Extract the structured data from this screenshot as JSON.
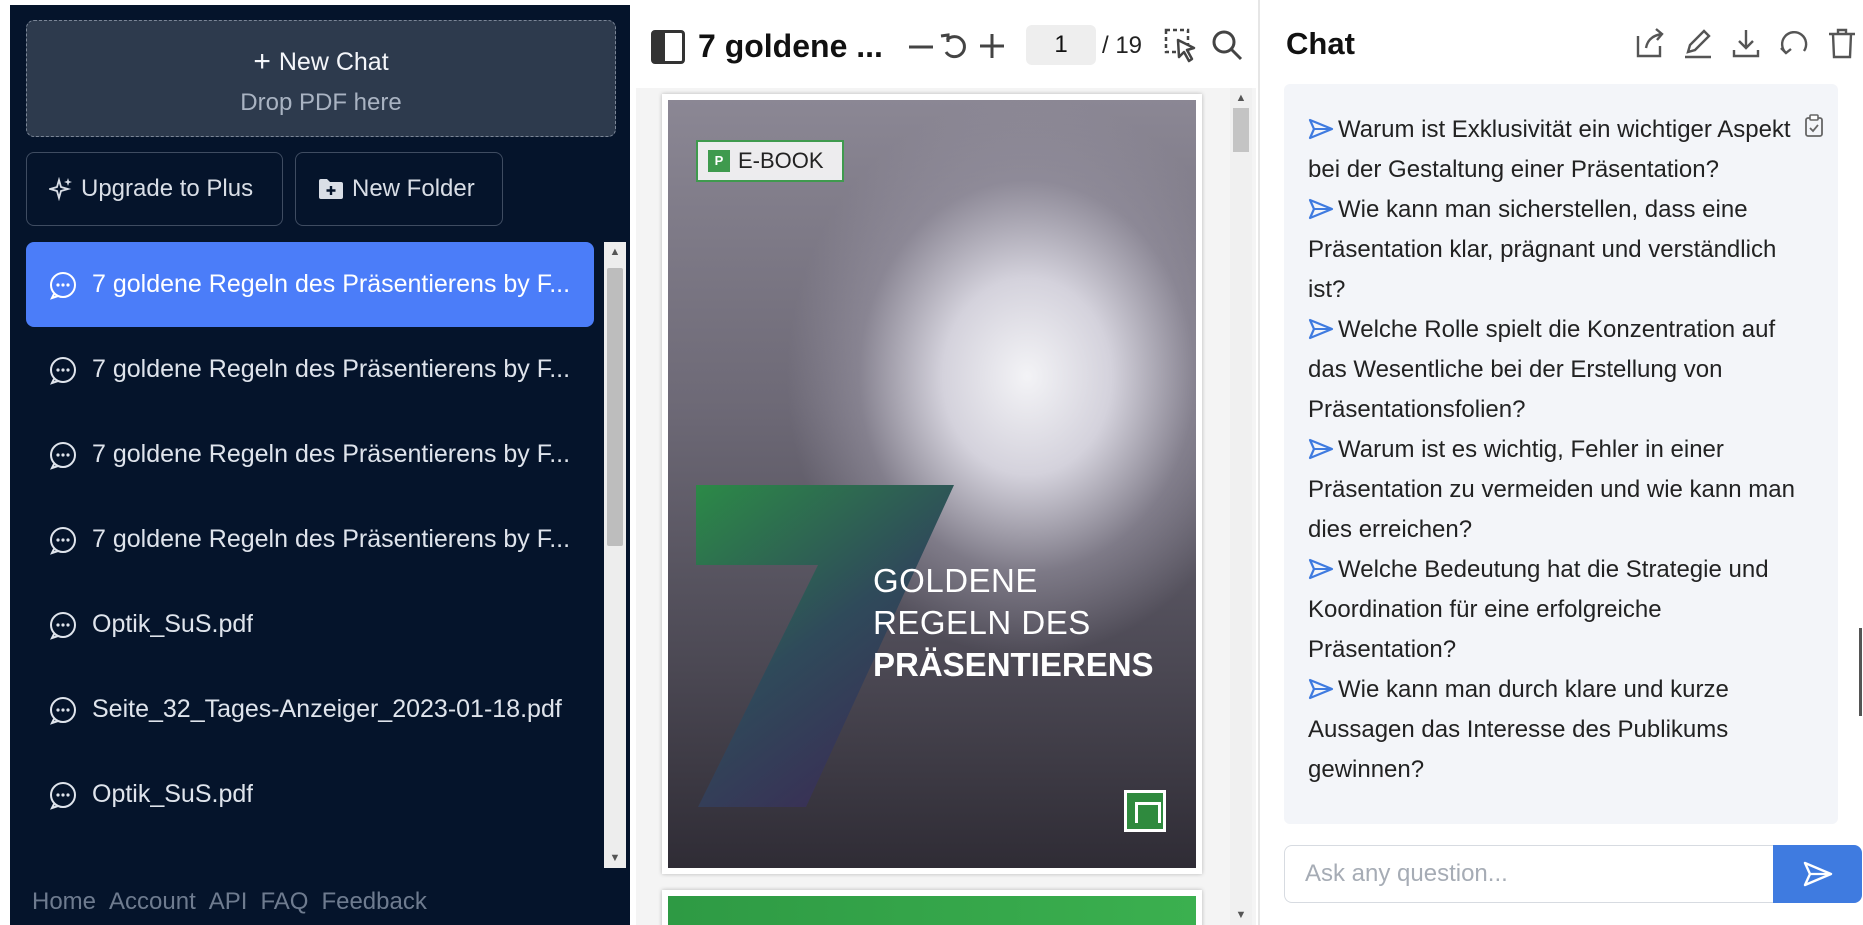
{
  "sidebar": {
    "new_chat": {
      "label": "New Chat",
      "sublabel": "Drop PDF here"
    },
    "upgrade_label": "Upgrade to Plus",
    "new_folder_label": "New Folder",
    "chats": [
      {
        "label": "7 goldene Regeln des Präsentierens by F...",
        "active": true
      },
      {
        "label": "7 goldene Regeln des Präsentierens by F...",
        "active": false
      },
      {
        "label": "7 goldene Regeln des Präsentierens by F...",
        "active": false
      },
      {
        "label": "7 goldene Regeln des Präsentierens by F...",
        "active": false
      },
      {
        "label": "Optik_SuS.pdf",
        "active": false
      },
      {
        "label": "Seite_32_Tages-Anzeiger_2023-01-18.pdf",
        "active": false
      },
      {
        "label": "Optik_SuS.pdf",
        "active": false
      }
    ],
    "footer": [
      "Home",
      "Account",
      "API",
      "FAQ",
      "Feedback"
    ]
  },
  "viewer": {
    "title": "7 goldene ...",
    "page_current": "1",
    "page_total": "/ 19",
    "cover": {
      "badge": "E-BOOK",
      "badge_icon": "P",
      "big_number": "7",
      "line1": "GOLDENE",
      "line2": "REGELN DES",
      "line3": "PRÄSENTIERENS"
    }
  },
  "chat": {
    "title": "Chat",
    "suggestions": [
      "Warum ist Exklusivität ein wichtiger Aspekt bei der Gestaltung einer Präsentation?",
      "Wie kann man sicherstellen, dass eine Präsentation klar, prägnant und verständlich ist?",
      "Welche Rolle spielt die Konzentration auf das Wesentliche bei der Erstellung von Präsentationsfolien?",
      "Warum ist es wichtig, Fehler in einer Präsentation zu vermeiden und wie kann man dies erreichen?",
      "Welche Bedeutung hat die Strategie und Koordination für eine erfolgreiche Präsentation?",
      "Wie kann man durch klare und kurze Aussagen das Interesse des Publikums gewinnen?"
    ],
    "input_placeholder": "Ask any question..."
  },
  "colors": {
    "sidebar_bg": "#05142b",
    "active_item": "#4b7df9",
    "accent": "#3f7be0"
  }
}
